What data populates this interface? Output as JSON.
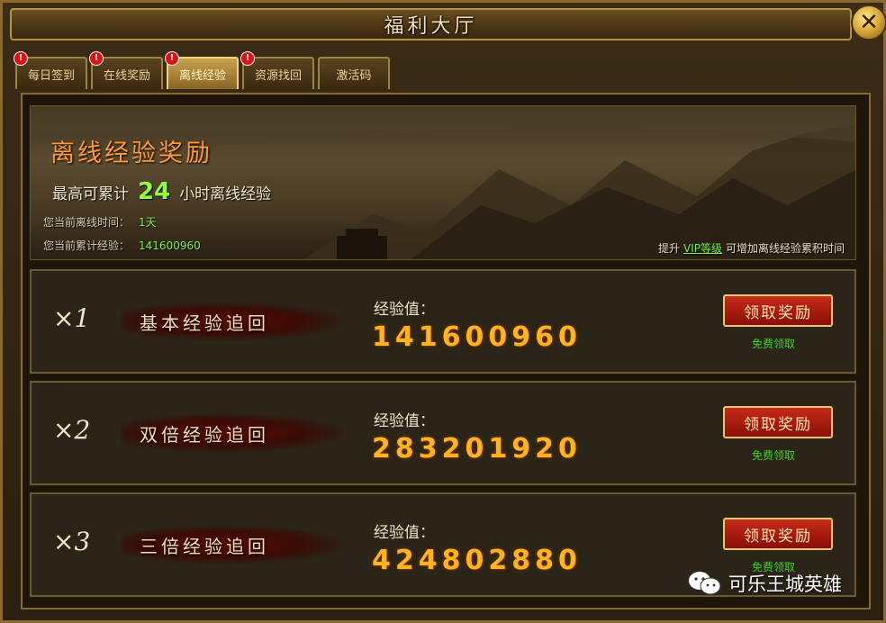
{
  "window": {
    "title": "福利大厅",
    "close_label": "✕"
  },
  "tabs": [
    {
      "label": "每日签到",
      "badge": "!"
    },
    {
      "label": "在线奖励",
      "badge": "!"
    },
    {
      "label": "离线经验",
      "badge": "!",
      "active": true
    },
    {
      "label": "资源找回",
      "badge": "!"
    },
    {
      "label": "激活码",
      "badge": ""
    }
  ],
  "banner": {
    "heading": "离线经验奖励",
    "accum_prefix": "最高可累计",
    "accum_hours": "24",
    "accum_suffix": "小时离线经验",
    "offline_time_label": "您当前离线时间：",
    "offline_time_value": "1天",
    "accum_exp_label": "您当前累计经验：",
    "accum_exp_value": "141600960",
    "vip_prefix": "提升",
    "vip_link": "VIP等级",
    "vip_suffix": "可增加离线经验累积时间"
  },
  "rows": [
    {
      "multiplier": "×1",
      "title": "基本经验追回",
      "exp_label": "经验值：",
      "exp_value": "141600960",
      "button": "领取奖励",
      "note": "免费领取"
    },
    {
      "multiplier": "×2",
      "title": "双倍经验追回",
      "exp_label": "经验值：",
      "exp_value": "283201920",
      "button": "领取奖励",
      "note": "免费领取"
    },
    {
      "multiplier": "×3",
      "title": "三倍经验追回",
      "exp_label": "经验值：",
      "exp_value": "424802880",
      "button": "领取奖励",
      "note": "免费领取"
    }
  ],
  "watermark": {
    "text": "可乐王城英雄",
    "icon": "wechat-icon"
  },
  "colors": {
    "accent_gold": "#ffb321",
    "heading_orange": "#ff9a3c",
    "green": "#7ef03a",
    "button_red": "#c62a1a"
  }
}
